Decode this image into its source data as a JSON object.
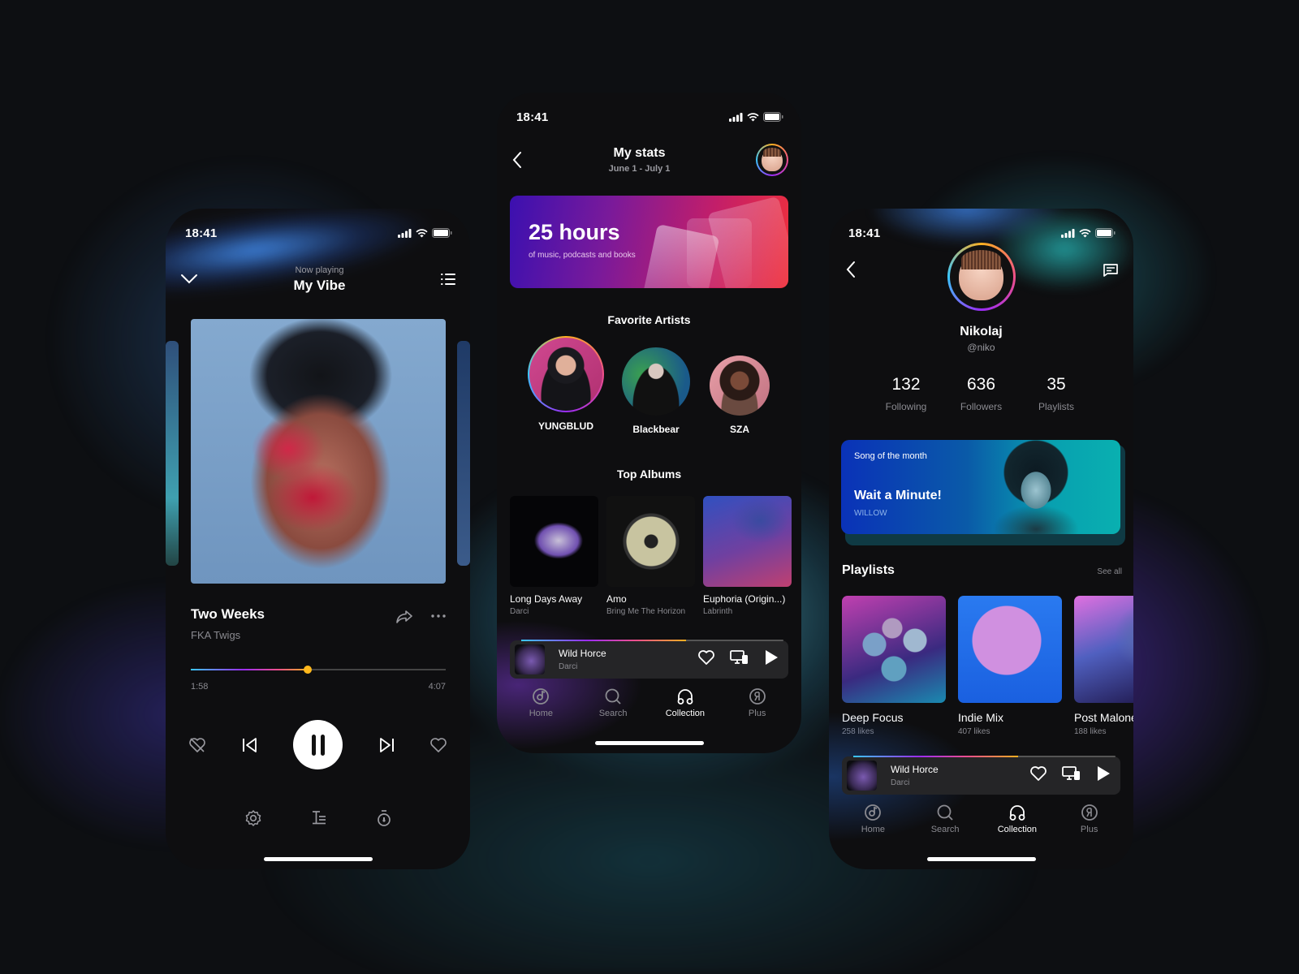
{
  "status_bar": {
    "time": "18:41"
  },
  "player": {
    "header": {
      "label": "Now playing",
      "playlist": "My Vibe"
    },
    "track": {
      "title": "Two Weeks",
      "artist": "FKA Twigs"
    },
    "progress": {
      "elapsed": "1:58",
      "total": "4:07",
      "fraction": 0.46
    },
    "icons": {
      "collapse": "chevron-down-icon",
      "queue": "list-icon",
      "share": "share-icon",
      "more": "more-icon",
      "dislike": "heart-off-icon",
      "previous": "skip-back-icon",
      "pause": "pause-icon",
      "next": "skip-forward-icon",
      "like": "heart-icon",
      "settings": "gear-icon",
      "lyrics": "lyrics-icon",
      "timer": "timer-icon"
    }
  },
  "stats": {
    "header": {
      "title": "My stats",
      "date_range": "June 1 - July 1"
    },
    "hours_card": {
      "value": "25 hours",
      "subtitle": "of music, podcasts and books"
    },
    "favorite_artists": {
      "title": "Favorite Artists",
      "items": [
        {
          "name": "YUNGBLUD"
        },
        {
          "name": "Blackbear"
        },
        {
          "name": "SZA"
        }
      ]
    },
    "top_albums": {
      "title": "Top Albums",
      "items": [
        {
          "title": "Long Days Away",
          "artist": "Darci"
        },
        {
          "title": "Amo",
          "artist": "Bring Me The Horizon"
        },
        {
          "title": "Euphoria (Origin...)",
          "artist": "Labrinth"
        }
      ]
    }
  },
  "mini_player": {
    "title": "Wild Horce",
    "artist": "Darci",
    "progress_fraction": 0.63
  },
  "tabbar": {
    "items": [
      {
        "label": "Home",
        "icon": "home-music-icon",
        "active": false
      },
      {
        "label": "Search",
        "icon": "search-icon",
        "active": false
      },
      {
        "label": "Collection",
        "icon": "headphones-icon",
        "active": true
      },
      {
        "label": "Plus",
        "icon": "plus-icon",
        "active": false
      }
    ]
  },
  "profile": {
    "name": "Nikolaj",
    "handle": "@niko",
    "stats": [
      {
        "value": "132",
        "label": "Following"
      },
      {
        "value": "636",
        "label": "Followers"
      },
      {
        "value": "35",
        "label": "Playlists"
      }
    ],
    "song_of_month": {
      "label": "Song of the month",
      "title": "Wait a Minute!",
      "artist": "WILLOW"
    },
    "playlists": {
      "title": "Playlists",
      "see_all": "See all",
      "items": [
        {
          "title": "Deep Focus",
          "likes": "258 likes"
        },
        {
          "title": "Indie Mix",
          "likes": "407 likes"
        },
        {
          "title": "Post Malone",
          "likes": "188 likes"
        }
      ]
    }
  },
  "colors": {
    "accent_gradient": [
      "#3ac8ff",
      "#9b2cf5",
      "#f0508a",
      "#ffb020"
    ],
    "background": "#0e0e10",
    "thumb": "#ffb81c"
  }
}
